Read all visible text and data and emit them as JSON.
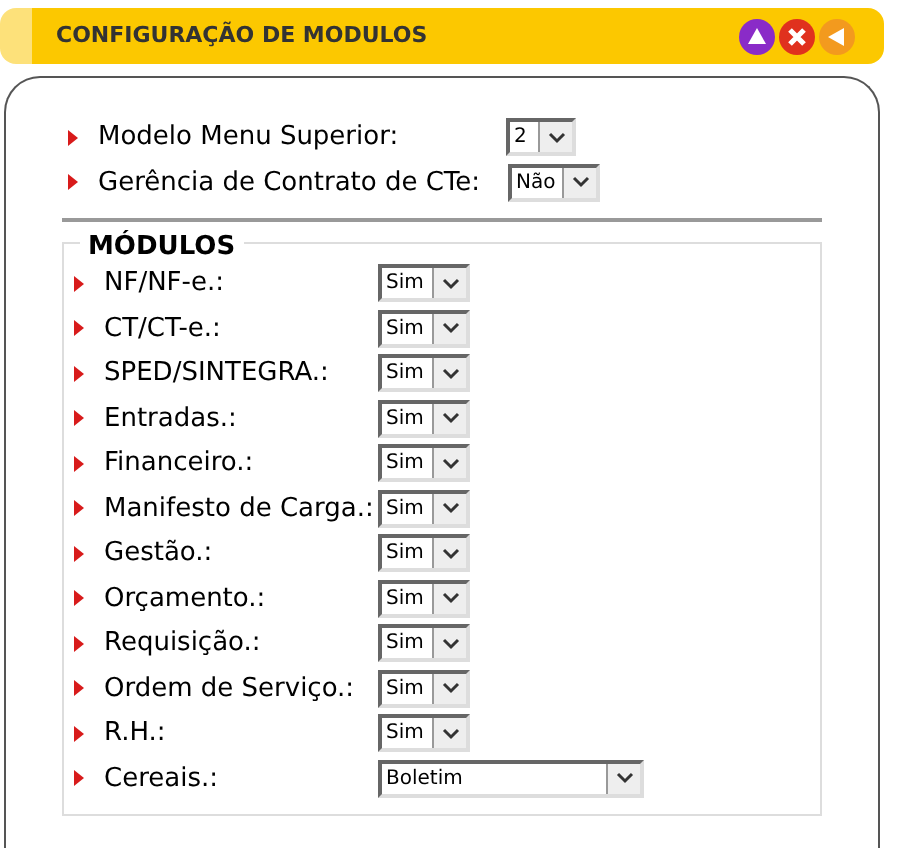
{
  "header": {
    "title": "CONFIGURAÇÃO DE MODULOS"
  },
  "settings": [
    {
      "label": "Modelo Menu Superior:",
      "value": "2"
    },
    {
      "label": "Gerência de Contrato de CTe:",
      "value": "Não"
    }
  ],
  "modules": {
    "legend": "MÓDULOS",
    "rows": [
      {
        "label": "NF/NF-e.:",
        "value": "Sim",
        "kind": "short"
      },
      {
        "label": "CT/CT-e.:",
        "value": "Sim",
        "kind": "short"
      },
      {
        "label": "SPED/SINTEGRA.:",
        "value": "Sim",
        "kind": "short"
      },
      {
        "label": "Entradas.:",
        "value": "Sim",
        "kind": "short"
      },
      {
        "label": "Financeiro.:",
        "value": "Sim",
        "kind": "short"
      },
      {
        "label": "Manifesto de Carga.:",
        "value": "Sim",
        "kind": "short"
      },
      {
        "label": "Gestão.:",
        "value": "Sim",
        "kind": "short"
      },
      {
        "label": "Orçamento.:",
        "value": "Sim",
        "kind": "short"
      },
      {
        "label": "Requisição.:",
        "value": "Sim",
        "kind": "short"
      },
      {
        "label": "Ordem de Serviço.:",
        "value": "Sim",
        "kind": "short"
      },
      {
        "label": "R.H.:",
        "value": "Sim",
        "kind": "short"
      },
      {
        "label": "Cereais.:",
        "value": "Boletim",
        "kind": "wide"
      }
    ]
  }
}
